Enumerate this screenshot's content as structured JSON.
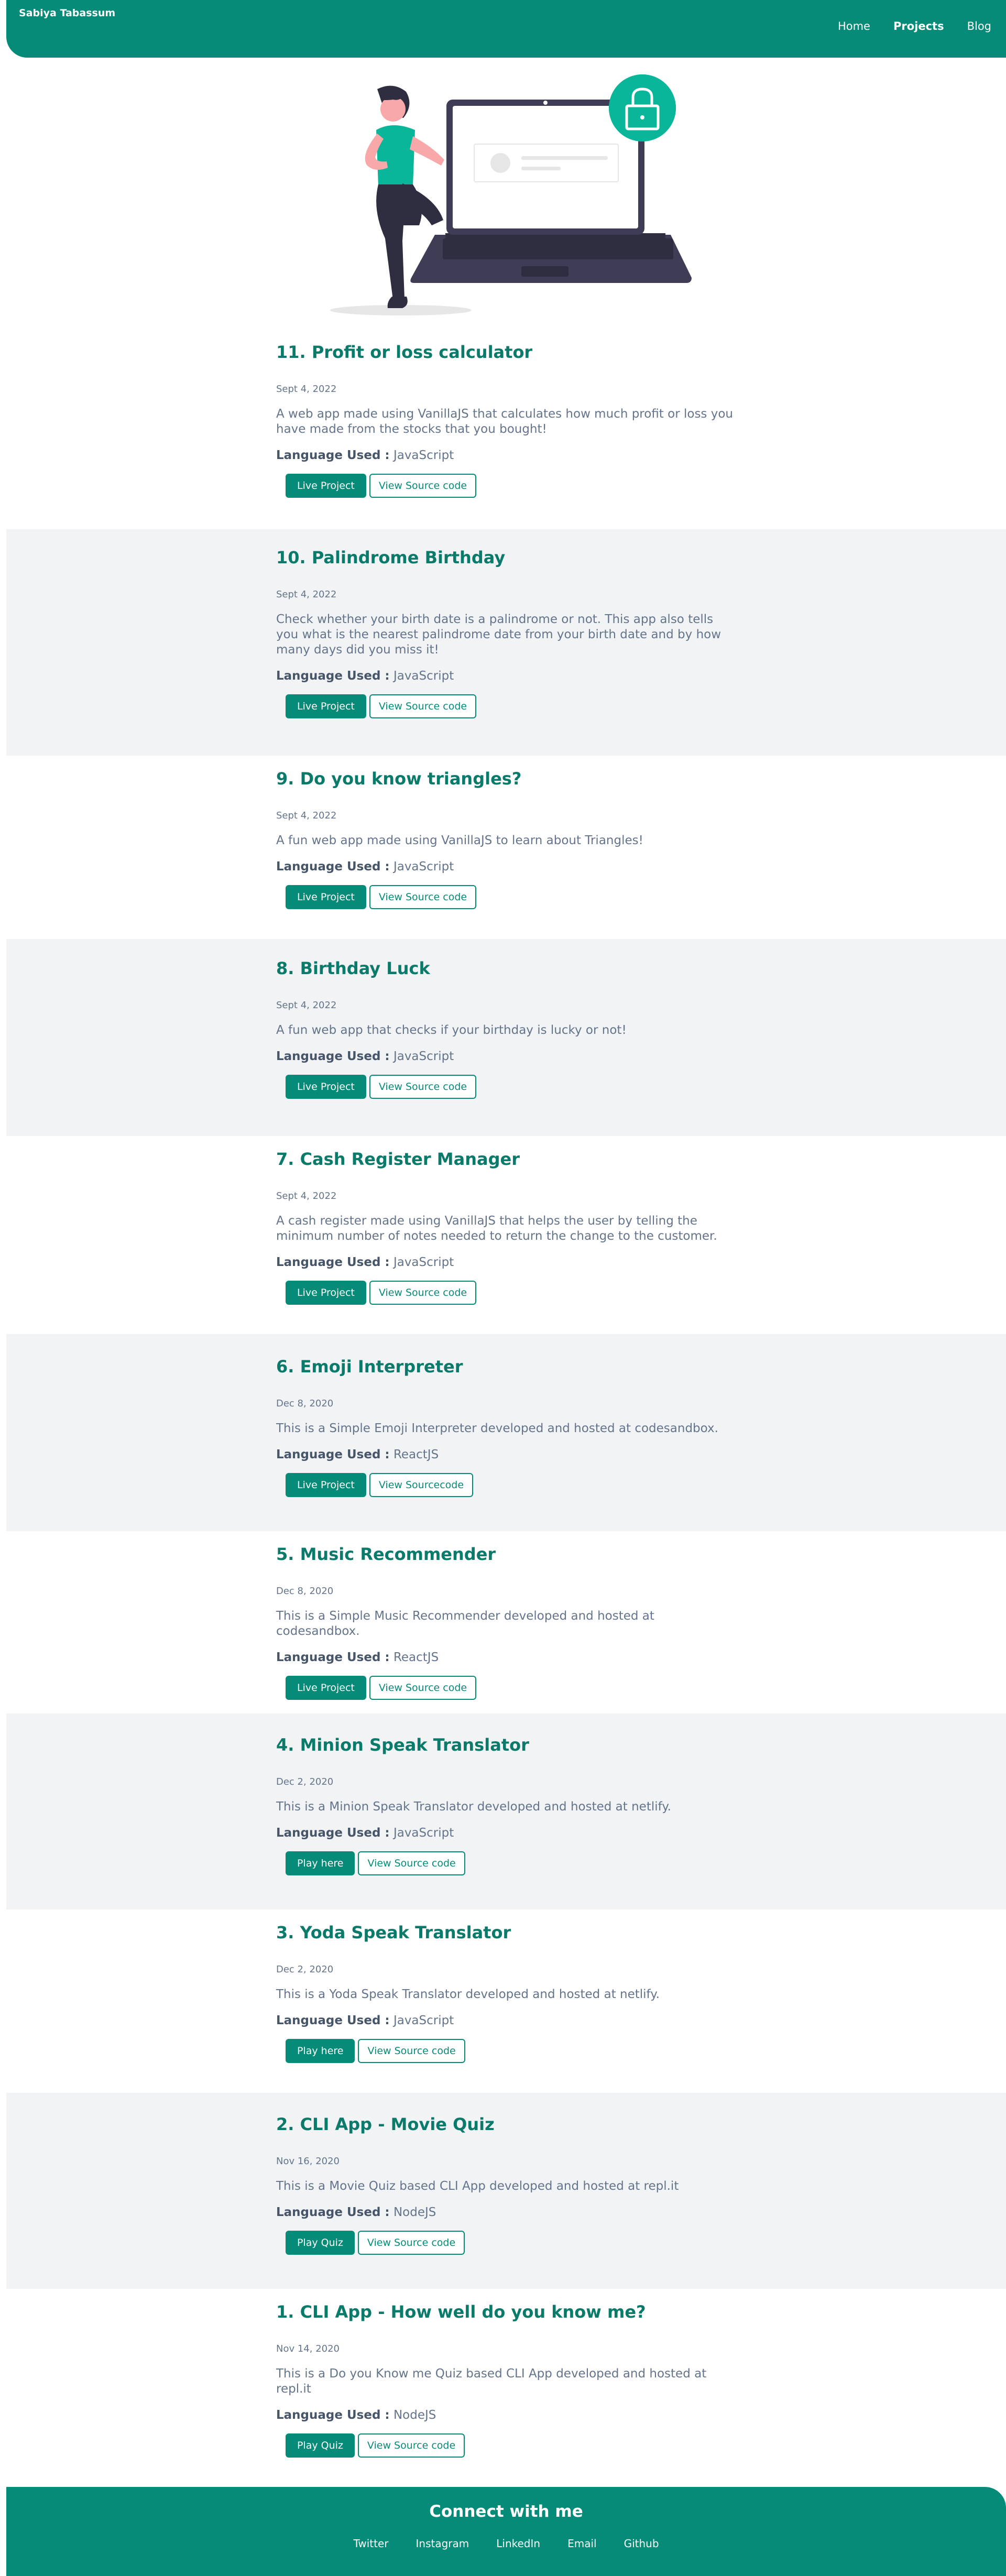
{
  "header": {
    "brand": "Sabiya Tabassum",
    "nav": [
      {
        "label": "Home",
        "active": false
      },
      {
        "label": "Projects",
        "active": true
      },
      {
        "label": "Blog",
        "active": false
      }
    ]
  },
  "hero": {
    "illustration": "woman-with-laptop-lock-illustration"
  },
  "projects": [
    {
      "title": "11. Profit or loss calculator",
      "date": "Sept 4, 2022",
      "description": "A web app made using VanillaJS that calculates how much profit or loss you have made from the stocks that you bought!",
      "language_label": "Language Used :",
      "language": "JavaScript",
      "primary_button": "Live Project",
      "secondary_button": "View Source code"
    },
    {
      "title": "10. Palindrome Birthday",
      "date": "Sept 4, 2022",
      "description": "Check whether your birth date is a palindrome or not. This app also tells you what is the nearest palindrome date from your birth date and by how many days did you miss it!",
      "language_label": "Language Used :",
      "language": "JavaScript",
      "primary_button": "Live Project",
      "secondary_button": "View Source code"
    },
    {
      "title": "9. Do you know triangles?",
      "date": "Sept 4, 2022",
      "description": "A fun web app made using VanillaJS to learn about Triangles!",
      "language_label": "Language Used :",
      "language": "JavaScript",
      "primary_button": "Live Project",
      "secondary_button": "View Source code"
    },
    {
      "title": "8. Birthday Luck",
      "date": "Sept 4, 2022",
      "description": "A fun web app that checks if your birthday is lucky or not!",
      "language_label": "Language Used :",
      "language": "JavaScript",
      "primary_button": "Live Project",
      "secondary_button": "View Source code"
    },
    {
      "title": "7. Cash Register Manager",
      "date": "Sept 4, 2022",
      "description": "A cash register made using VanillaJS that helps the user by telling the minimum number of notes needed to return the change to the customer.",
      "language_label": "Language Used :",
      "language": "JavaScript",
      "primary_button": "Live Project",
      "secondary_button": "View Source code"
    },
    {
      "title": "6. Emoji Interpreter",
      "date": "Dec 8, 2020",
      "description": "This is a Simple Emoji Interpreter developed and hosted at codesandbox.",
      "language_label": "Language Used :",
      "language": "ReactJS",
      "primary_button": "Live Project",
      "secondary_button": "View Sourcecode"
    },
    {
      "title": "5. Music Recommender",
      "date": "Dec 8, 2020",
      "description": "This is a Simple Music Recommender developed and hosted at codesandbox.",
      "language_label": "Language Used :",
      "language": "ReactJS",
      "primary_button": "Live Project",
      "secondary_button": "View Source code"
    },
    {
      "title": "4. Minion Speak Translator",
      "date": "Dec 2, 2020",
      "description": "This is a Minion Speak Translator developed and hosted at netlify.",
      "language_label": "Language Used :",
      "language": "JavaScript",
      "primary_button": "Play here",
      "secondary_button": "View Source code"
    },
    {
      "title": "3. Yoda Speak Translator",
      "date": "Dec 2, 2020",
      "description": "This is a Yoda Speak Translator developed and hosted at netlify.",
      "language_label": "Language Used :",
      "language": "JavaScript",
      "primary_button": "Play here",
      "secondary_button": "View Source code"
    },
    {
      "title": "2. CLI App - Movie Quiz",
      "date": "Nov 16, 2020",
      "description": "This is a Movie Quiz based CLI App developed and hosted at repl.it",
      "language_label": "Language Used :",
      "language": "NodeJS",
      "primary_button": "Play Quiz",
      "secondary_button": "View Source code"
    },
    {
      "title": "1. CLI App - How well do you know me?",
      "date": "Nov 14, 2020",
      "description": "This is a Do you Know me Quiz based CLI App developed and hosted at repl.it",
      "language_label": "Language Used :",
      "language": "NodeJS",
      "primary_button": "Play Quiz",
      "secondary_button": "View Source code"
    }
  ],
  "footer": {
    "title": "Connect with me",
    "links": [
      "Twitter",
      "Instagram",
      "LinkedIn",
      "Email",
      "Github"
    ]
  },
  "colors": {
    "primary": "#058b78",
    "title": "#0a7a6a",
    "alt_background": "#f1f3f5",
    "text": "#64748b"
  }
}
